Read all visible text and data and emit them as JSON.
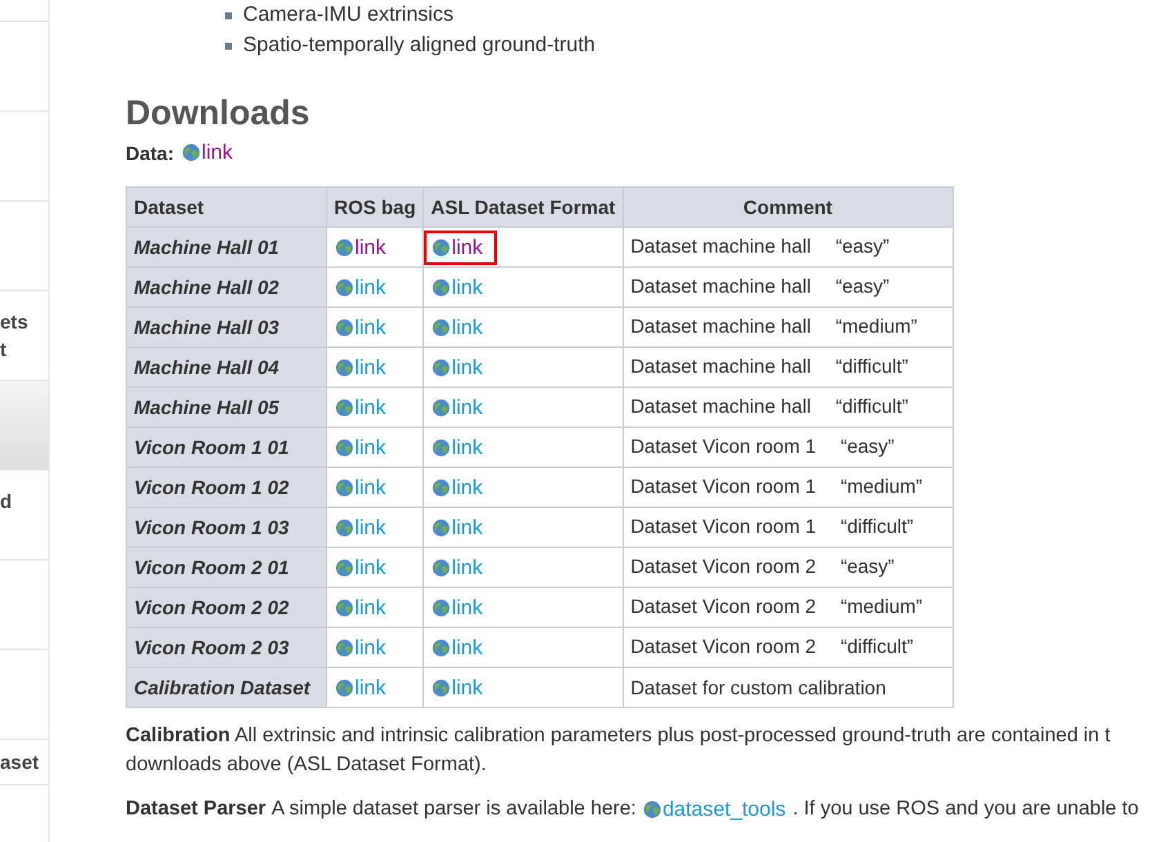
{
  "sidebar": {
    "items": [
      {
        "selected": false
      },
      {
        "selected": false
      },
      {
        "selected": false
      },
      {
        "selected": false
      },
      {
        "lines": [
          "ets",
          "t"
        ],
        "selected": false
      },
      {
        "selected": true
      },
      {
        "lines": [
          "d"
        ],
        "selected": false
      },
      {
        "selected": false
      },
      {
        "selected": false
      },
      {
        "lines": [
          "aset"
        ],
        "selected": false
      }
    ]
  },
  "bullets": [
    "Camera-IMU extrinsics",
    "Spatio-temporally aligned ground-truth"
  ],
  "heading": "Downloads",
  "data_line": {
    "label": "Data:",
    "link": {
      "text": "link",
      "visited": true
    }
  },
  "table": {
    "columns": [
      "Dataset",
      "ROS bag",
      "ASL Dataset Format",
      "Comment"
    ],
    "rows": [
      {
        "dataset": "Machine Hall 01",
        "ros": {
          "text": "link",
          "visited": true
        },
        "asl": {
          "text": "link",
          "visited": true,
          "highlighted": true
        },
        "comment": "Dataset machine hall 　“easy”"
      },
      {
        "dataset": "Machine Hall 02",
        "ros": {
          "text": "link",
          "visited": false
        },
        "asl": {
          "text": "link",
          "visited": false,
          "highlighted": false
        },
        "comment": "Dataset machine hall 　“easy”"
      },
      {
        "dataset": "Machine Hall 03",
        "ros": {
          "text": "link",
          "visited": false
        },
        "asl": {
          "text": "link",
          "visited": false,
          "highlighted": false
        },
        "comment": "Dataset machine hall 　“medium”"
      },
      {
        "dataset": "Machine Hall 04",
        "ros": {
          "text": "link",
          "visited": false
        },
        "asl": {
          "text": "link",
          "visited": false,
          "highlighted": false
        },
        "comment": "Dataset machine hall 　“difficult”"
      },
      {
        "dataset": "Machine Hall 05",
        "ros": {
          "text": "link",
          "visited": false
        },
        "asl": {
          "text": "link",
          "visited": false,
          "highlighted": false
        },
        "comment": "Dataset machine hall 　“difficult”"
      },
      {
        "dataset": "Vicon Room 1 01",
        "ros": {
          "text": "link",
          "visited": false
        },
        "asl": {
          "text": "link",
          "visited": false,
          "highlighted": false
        },
        "comment": "Dataset Vicon room 1 　“easy”"
      },
      {
        "dataset": "Vicon Room 1 02",
        "ros": {
          "text": "link",
          "visited": false
        },
        "asl": {
          "text": "link",
          "visited": false,
          "highlighted": false
        },
        "comment": "Dataset Vicon room 1 　“medium”"
      },
      {
        "dataset": "Vicon Room 1 03",
        "ros": {
          "text": "link",
          "visited": false
        },
        "asl": {
          "text": "link",
          "visited": false,
          "highlighted": false
        },
        "comment": "Dataset Vicon room 1 　“difficult”"
      },
      {
        "dataset": "Vicon Room 2 01",
        "ros": {
          "text": "link",
          "visited": false
        },
        "asl": {
          "text": "link",
          "visited": false,
          "highlighted": false
        },
        "comment": "Dataset Vicon room 2 　“easy”"
      },
      {
        "dataset": "Vicon Room 2 02",
        "ros": {
          "text": "link",
          "visited": false
        },
        "asl": {
          "text": "link",
          "visited": false,
          "highlighted": false
        },
        "comment": "Dataset Vicon room 2 　“medium”"
      },
      {
        "dataset": "Vicon Room 2 03",
        "ros": {
          "text": "link",
          "visited": false
        },
        "asl": {
          "text": "link",
          "visited": false,
          "highlighted": false
        },
        "comment": "Dataset Vicon room 2 　“difficult”"
      },
      {
        "dataset": "Calibration Dataset",
        "ros": {
          "text": "link",
          "visited": false
        },
        "asl": {
          "text": "link",
          "visited": false,
          "highlighted": false
        },
        "comment": "Dataset for custom calibration"
      }
    ]
  },
  "calibration": {
    "lines": [
      "**Calibration** All extrinsic and intrinsic calibration parameters plus post-processed ground-truth are contained in t",
      "downloads above (ASL Dataset Format)."
    ]
  },
  "parser": {
    "label": "Dataset Parser",
    "before": "A simple dataset parser is available here:",
    "link": {
      "text": "dataset_tools",
      "visited": false
    },
    "after": ". If you use ROS and you are unable to"
  }
}
